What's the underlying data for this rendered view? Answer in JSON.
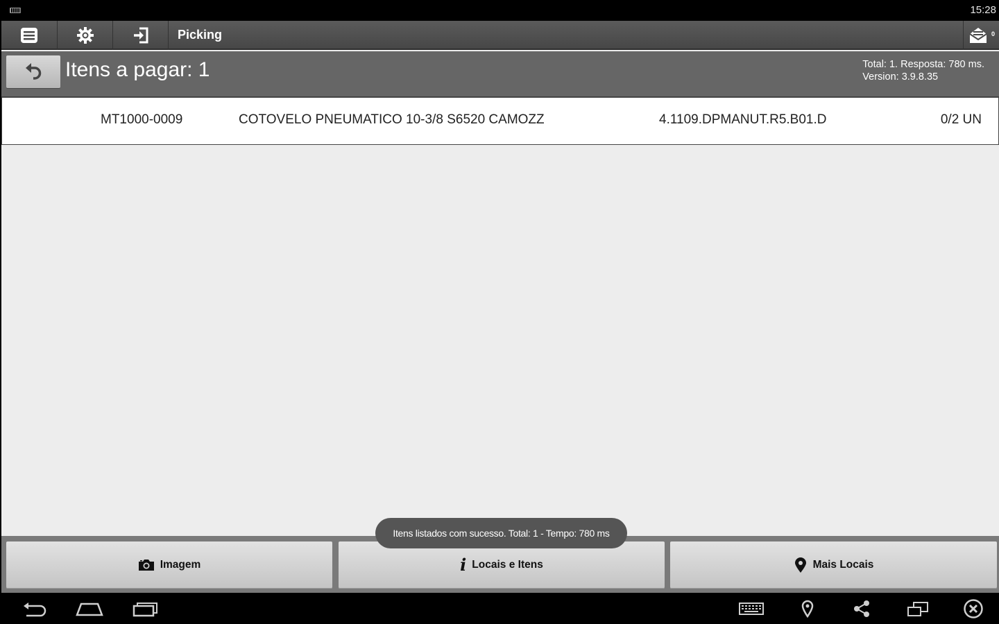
{
  "status_bar": {
    "time": "15:28"
  },
  "action_bar": {
    "title": "Picking",
    "message_count": "0",
    "icons": [
      "list-icon",
      "gear-icon",
      "login-icon",
      "mail-icon"
    ]
  },
  "header": {
    "title": "Itens a pagar: 1",
    "total_line": "Total: 1. Resposta: 780 ms.",
    "version_line": "Version: 3.9.8.35"
  },
  "list": {
    "items": [
      {
        "code": "MT1000-0009",
        "description": "COTOVELO PNEUMATICO 10-3/8 S6520 CAMOZZ",
        "location": "4.1109.DPMANUT.R5.B01.D",
        "quantity": "0/2 UN"
      }
    ]
  },
  "toast": {
    "text": "Itens listados com sucesso. Total: 1 - Tempo: 780 ms"
  },
  "bottom_bar": {
    "imagem_label": "Imagem",
    "locais_label": "Locais e Itens",
    "mais_label": "Mais Locais"
  },
  "nav_bar": {
    "icons": [
      "back-icon",
      "home-icon",
      "recents-icon",
      "keyboard-icon",
      "location-icon",
      "share-icon",
      "screen-rotate-icon",
      "close-icon"
    ]
  },
  "colors": {
    "action_bar": "#4f4f4f",
    "header_panel": "#666666",
    "content_bg": "#ededed",
    "toast_bg": "#555555"
  }
}
